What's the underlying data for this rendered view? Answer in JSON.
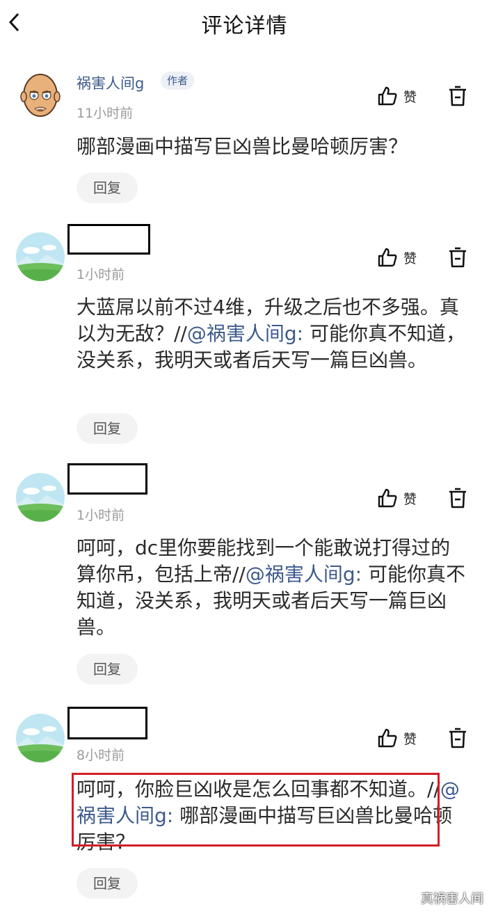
{
  "header": {
    "title": "评论详情",
    "back_icon": "chevron-left-icon"
  },
  "actions": {
    "like_label": "赞",
    "reply_label": "回复"
  },
  "comments": [
    {
      "username": "祸害人间g",
      "badge": "作者",
      "time": "11小时前",
      "text": "哪部漫画中描写巨凶兽比曼哈顿厉害？"
    },
    {
      "username_redacted": true,
      "time": "1小时前",
      "text_before": "大蓝屌以前不过4维，升级之后也不多强。真以为无敌？//",
      "mention": "@祸害人间g:",
      "text_after": " 可能你真不知道，没关系，我明天或者后天写一篇巨凶兽。"
    },
    {
      "username_redacted": true,
      "time": "1小时前",
      "text_before": "呵呵，dc里你要能找到一个能敢说打得过的算你吊，包括上帝//",
      "mention": "@祸害人间g:",
      "text_after": " 可能你真不知道，没关系，我明天或者后天写一篇巨凶兽。"
    },
    {
      "username_redacted": true,
      "time": "8小时前",
      "text_before": "呵呵，你脸巨凶收是怎么回事都不知道。//",
      "mention": "@祸害人间g:",
      "text_after": " 哪部漫画中描写巨凶兽比曼哈顿厉害？"
    }
  ],
  "watermark": "真祸害人间",
  "colors": {
    "mention": "#3d5a8c",
    "highlight_border": "#d21e25"
  }
}
